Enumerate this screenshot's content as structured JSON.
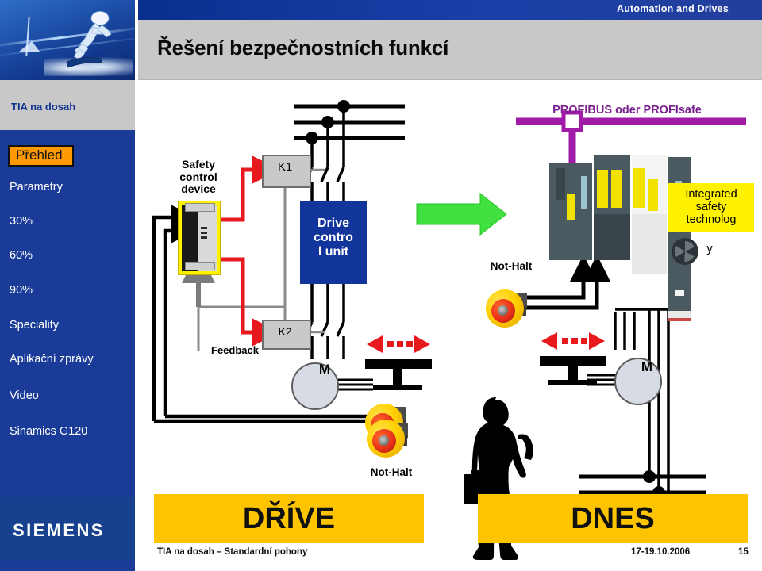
{
  "header": {
    "banner_label": "Automation and Drives",
    "title": "Řešení bezpečnostních funkcí"
  },
  "sidebar": {
    "hero_icon": "snowboarder-hero-image",
    "rail_label": "TIA na dosah",
    "items": [
      {
        "label": "Přehled",
        "active": true
      },
      {
        "label": "Parametry",
        "active": false
      },
      {
        "label": "30%",
        "active": false
      },
      {
        "label": "60%",
        "active": false
      },
      {
        "label": "90%",
        "active": false
      },
      {
        "label": "Speciality",
        "active": false
      },
      {
        "label": "Aplikační zprávy",
        "active": false
      },
      {
        "label": "Video",
        "active": false
      },
      {
        "label": "Sinamics G120",
        "active": false
      }
    ],
    "logo": "SIEMENS"
  },
  "diagram": {
    "left_labels": {
      "safety_control_device": "Safety\ncontrol\ndevice",
      "k1": "K1",
      "k2": "K2",
      "feedback": "Feedback",
      "drive_control_unit": "Drive\ncontro\nl unit",
      "motor_left": "M",
      "motor_right": "M"
    },
    "right_labels": {
      "profibus": "PROFIBUS oder PROFIsafe",
      "integrated_safety": "Integrated\nsafety\ntechnolog",
      "integrated_safety_tail": "y",
      "not_halt_upper": "Not-Halt",
      "not_halt_lower": "Not-Halt"
    },
    "banners": {
      "left": "DŘÍVE",
      "right": "DNES"
    },
    "icons": {
      "green_arrow": "green-right-arrow-icon",
      "estop_button": "emergency-stop-button-icon",
      "person": "person-silhouette-icon",
      "fan": "fan-icon"
    }
  },
  "footer": {
    "left": "TIA na dosah – Standardní pohony",
    "date": "17-19.10.2006",
    "page": "15"
  },
  "colors": {
    "brand_blue": "#1a3c98",
    "banner_blue": "#173EA1",
    "accent_orange": "#FF9900",
    "accent_yellow": "#FFC400",
    "highlight_yellow": "#FFF200",
    "magenta": "#A01BA8",
    "green": "#3FE03F",
    "red": "#E8191C",
    "drive_blue": "#12359B"
  }
}
